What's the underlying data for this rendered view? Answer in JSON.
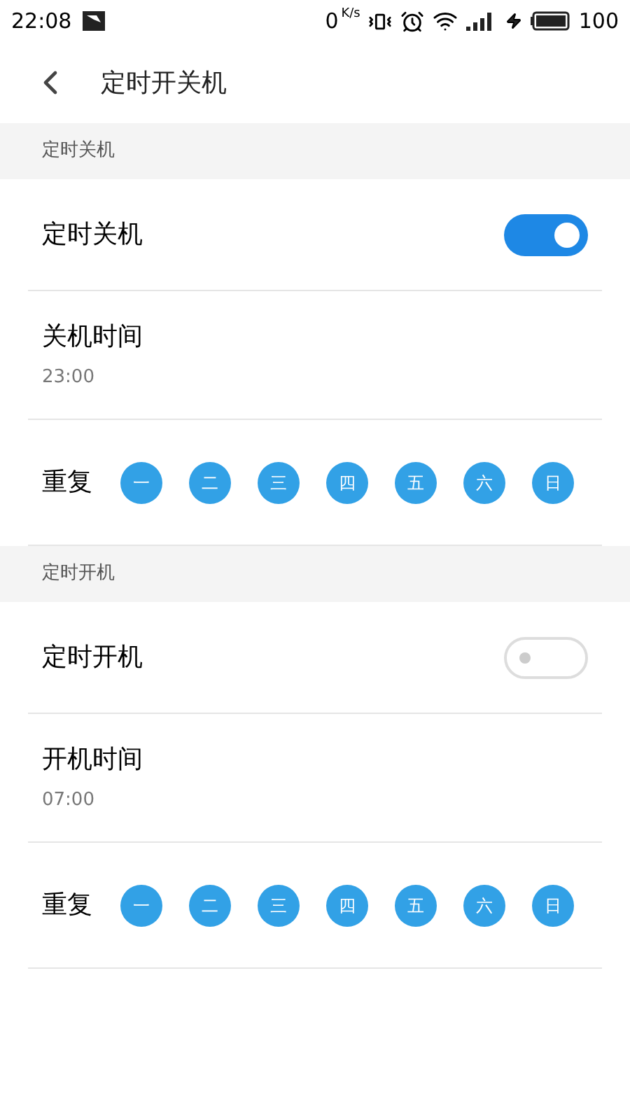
{
  "status_bar": {
    "time": "22:08",
    "speed": "0",
    "speed_unit": "K/s",
    "battery": "100"
  },
  "header": {
    "title": "定时开关机"
  },
  "sections": [
    {
      "heading": "定时关机",
      "toggle": {
        "label": "定时关机",
        "on": true
      },
      "time": {
        "label": "关机时间",
        "value": "23:00"
      },
      "repeat": {
        "label": "重复",
        "days": [
          {
            "label": "一",
            "selected": true
          },
          {
            "label": "二",
            "selected": true
          },
          {
            "label": "三",
            "selected": true
          },
          {
            "label": "四",
            "selected": true
          },
          {
            "label": "五",
            "selected": true
          },
          {
            "label": "六",
            "selected": true
          },
          {
            "label": "日",
            "selected": true
          }
        ]
      }
    },
    {
      "heading": "定时开机",
      "toggle": {
        "label": "定时开机",
        "on": false
      },
      "time": {
        "label": "开机时间",
        "value": "07:00"
      },
      "repeat": {
        "label": "重复",
        "days": [
          {
            "label": "一",
            "selected": true
          },
          {
            "label": "二",
            "selected": true
          },
          {
            "label": "三",
            "selected": true
          },
          {
            "label": "四",
            "selected": true
          },
          {
            "label": "五",
            "selected": true
          },
          {
            "label": "六",
            "selected": true
          },
          {
            "label": "日",
            "selected": true
          }
        ]
      }
    }
  ]
}
